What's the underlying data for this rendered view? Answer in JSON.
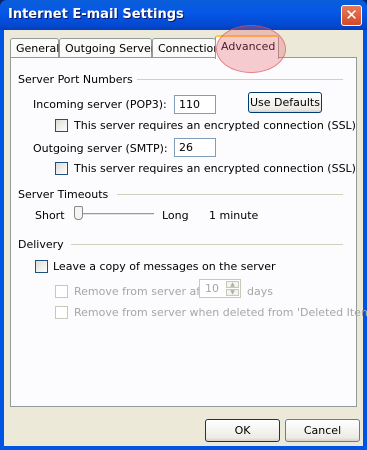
{
  "window": {
    "title": "Internet E-mail Settings",
    "close_glyph": "✕"
  },
  "tabs": [
    {
      "label": "General"
    },
    {
      "label": "Outgoing Server"
    },
    {
      "label": "Connection"
    },
    {
      "label": "Advanced",
      "selected": true
    }
  ],
  "server_ports": {
    "heading": "Server Port Numbers",
    "incoming_label": "Incoming server (POP3):",
    "incoming_value": "110",
    "use_defaults_label": "Use Defaults",
    "incoming_ssl_label": "This server requires an encrypted connection (SSL)",
    "incoming_ssl_checked": false,
    "outgoing_label": "Outgoing server (SMTP):",
    "outgoing_value": "26",
    "outgoing_ssl_label": "This server requires an encrypted connection (SSL)",
    "outgoing_ssl_checked": false
  },
  "timeouts": {
    "heading": "Server Timeouts",
    "short_label": "Short",
    "long_label": "Long",
    "value_label": "1 minute",
    "slider_level": 0
  },
  "delivery": {
    "heading": "Delivery",
    "leave_copy_label": "Leave a copy of messages on the server",
    "leave_copy_checked": false,
    "remove_after_label": "Remove from server after",
    "remove_after_value": "10",
    "days_label": "days",
    "remove_deleted_label": "Remove from server when deleted from 'Deleted Items'"
  },
  "buttons": {
    "ok_label": "OK",
    "cancel_label": "Cancel"
  },
  "colors": {
    "titlebar": "#0054e3",
    "close_button": "#d44a26",
    "tab_selected_accent": "#ffc83c",
    "face": "#ece9d8"
  }
}
